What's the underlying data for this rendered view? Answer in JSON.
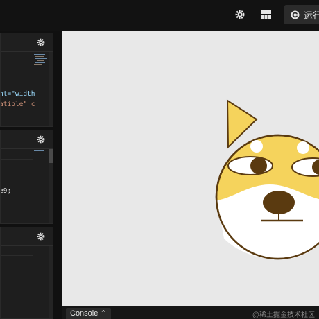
{
  "toolbar": {
    "icons": [
      "gear-icon",
      "layout-grid-icon"
    ],
    "run_label": "运行"
  },
  "panes": {
    "html": {
      "line1": "nt=\"width",
      "line2": "atible\" c"
    },
    "css": {
      "line1": "e9;"
    },
    "js": {}
  },
  "preview": {
    "drawing": "shiba-dog-face"
  },
  "console": {
    "tab_label": "Console ⌃"
  },
  "watermark": "@稀土掘金技术社区",
  "colors": {
    "accent_attr": "#9cdcfe",
    "string": "#ce9178",
    "dog_yellow": "#f5d35c",
    "dog_outline": "#5a3a10",
    "preview_bg": "#e8e8e8"
  }
}
